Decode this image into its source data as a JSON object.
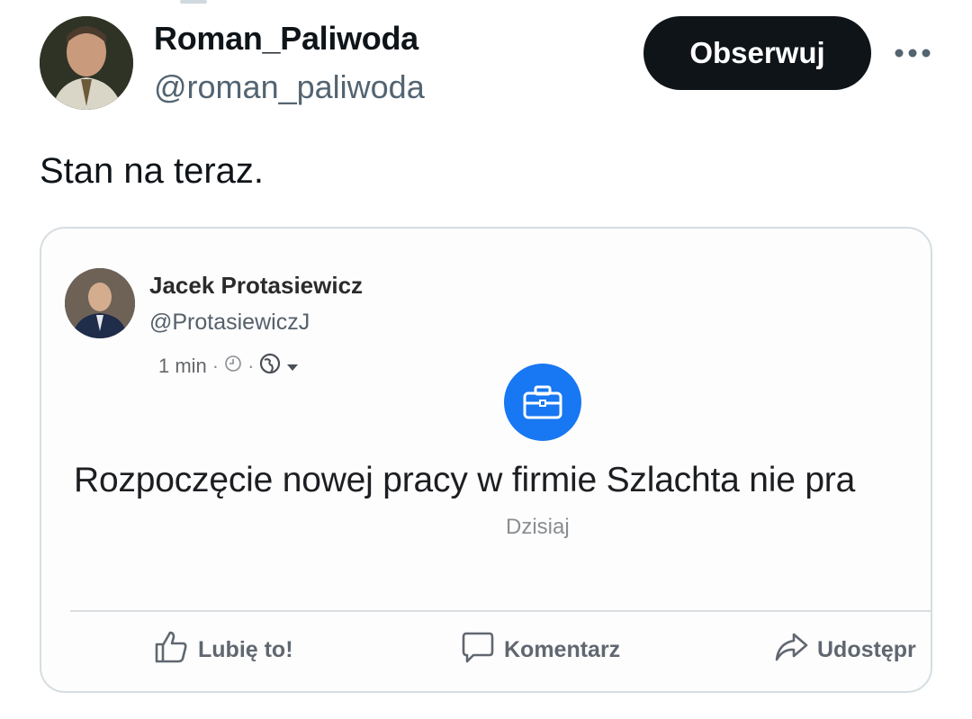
{
  "tweet": {
    "author": {
      "display_name": "Roman_Paliwoda",
      "handle": "@roman_paliwoda"
    },
    "follow_label": "Obserwuj",
    "text": "Stan na teraz."
  },
  "embedded_post": {
    "author_name": "Jacek Protasiewicz",
    "author_handle": "@ProtasiewiczJ",
    "time": "1 min",
    "event_title": "Rozpoczęcie nowej pracy w firmie Szlachta nie pra",
    "event_date": "Dzisiaj",
    "actions": {
      "like": "Lubię to!",
      "comment": "Komentarz",
      "share": "Udostępr"
    }
  },
  "colors": {
    "follow_bg": "#0f1419",
    "handle_gray": "#536471",
    "fb_blue": "#1877f2"
  }
}
